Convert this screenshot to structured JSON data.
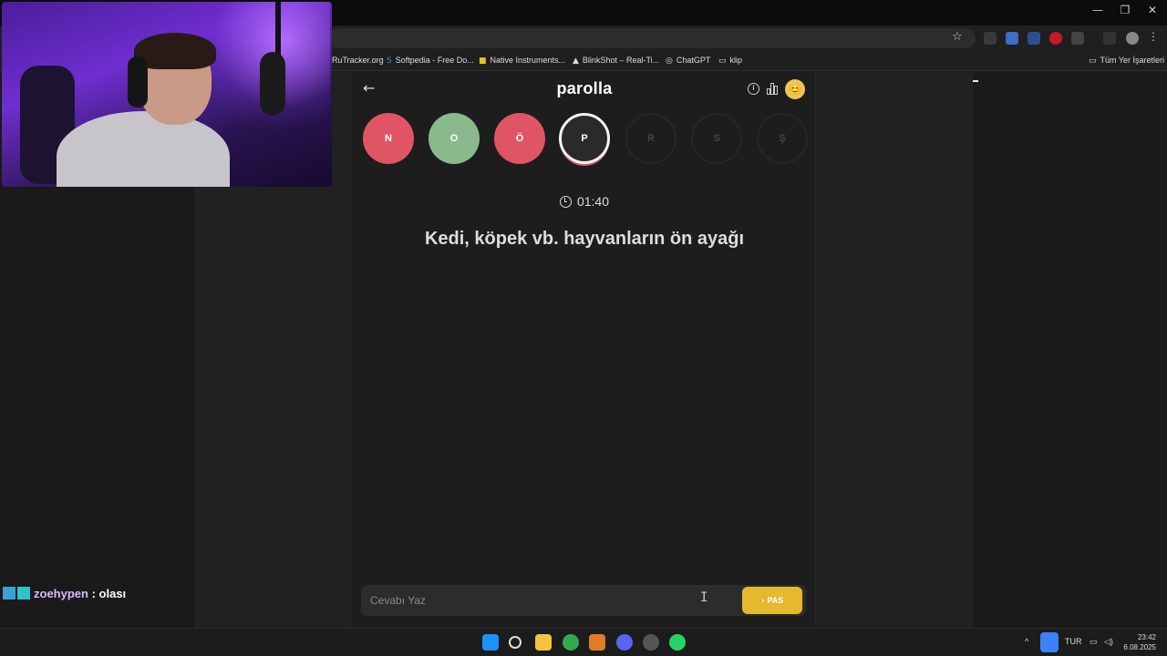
{
  "window": {
    "minimize_glyph": "—",
    "restore_glyph": "❐",
    "close_glyph": "✕"
  },
  "bookmarks": [
    {
      "label": "RuTracker.org",
      "icon": "rutracker-icon"
    },
    {
      "label": "Softpedia - Free Do...",
      "icon": "softpedia-icon"
    },
    {
      "label": "Native Instruments...",
      "icon": "folder-icon"
    },
    {
      "label": "BlinkShot – Real-Ti...",
      "icon": "triangle-icon"
    },
    {
      "label": "ChatGPT",
      "icon": "chatgpt-icon"
    },
    {
      "label": "klip",
      "icon": "folder-icon"
    }
  ],
  "all_bookmarks_label": "Tüm Yer İşaretleri",
  "app": {
    "title": "parolla",
    "letters": [
      {
        "char": "N",
        "state": "wrong"
      },
      {
        "char": "O",
        "state": "right"
      },
      {
        "char": "Ö",
        "state": "wrong"
      },
      {
        "char": "P",
        "state": "current"
      },
      {
        "char": "R",
        "state": "pending"
      },
      {
        "char": "S",
        "state": "pending"
      },
      {
        "char": "Ş",
        "state": "pending"
      }
    ],
    "timer": "01:40",
    "question": "Kedi, köpek vb. hayvanların ön ayağı",
    "answer_placeholder": "Cevabı Yaz",
    "pass_label": "PAS",
    "colors": {
      "wrong": "#e05565",
      "right": "#8ab98c",
      "pass": "#e5b82e"
    }
  },
  "chat": {
    "user": "zoehypen",
    "separator": " : ",
    "message": "olası"
  },
  "taskbar": {
    "language": "TUR",
    "time": "23:42",
    "date": "6.08.2025"
  }
}
